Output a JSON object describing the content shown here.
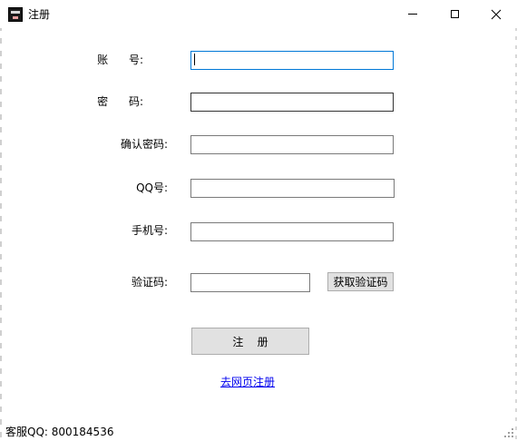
{
  "window": {
    "title": "注册",
    "controls": {
      "minimize_icon": "minimize-icon",
      "maximize_icon": "maximize-icon",
      "close_icon": "close-icon",
      "close_glyph": "✕"
    }
  },
  "form": {
    "account_label": "账      号:",
    "password_label": "密      码:",
    "confirm_password_label": "确认密码:",
    "qq_label": "QQ号:",
    "phone_label": "手机号:",
    "code_label": "验证码:",
    "account_value": "",
    "password_value": "",
    "confirm_password_value": "",
    "qq_value": "",
    "phone_value": "",
    "code_value": "",
    "get_code_button": "获取验证码",
    "register_button": "注    册",
    "web_register_link": "去网页注册"
  },
  "status": {
    "support_qq": "客服QQ:  800184536"
  },
  "colors": {
    "focus_border": "#0078d7",
    "link": "#0000ee",
    "button_bg": "#e1e1e1"
  }
}
